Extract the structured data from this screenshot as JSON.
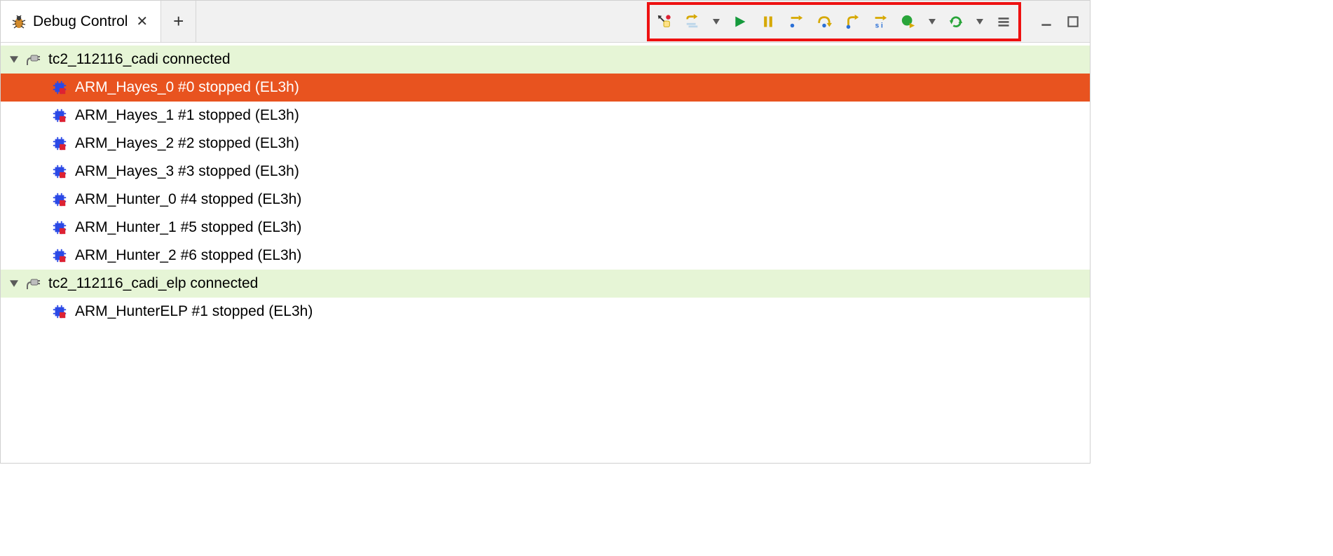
{
  "tab": {
    "title": "Debug Control"
  },
  "toolbar": {
    "buttons": [
      "connect",
      "stepmode",
      "run",
      "pause",
      "stepcode",
      "stepover",
      "stepout",
      "stepinstr",
      "runto",
      "refresh",
      "menu"
    ]
  },
  "connections": [
    {
      "name": "tc2_112116_cadi",
      "status": "connected",
      "expanded": true,
      "cores": [
        {
          "label": "ARM_Hayes_0 #0 stopped (EL3h)",
          "selected": true
        },
        {
          "label": "ARM_Hayes_1 #1 stopped (EL3h)",
          "selected": false
        },
        {
          "label": "ARM_Hayes_2 #2 stopped (EL3h)",
          "selected": false
        },
        {
          "label": "ARM_Hayes_3 #3 stopped (EL3h)",
          "selected": false
        },
        {
          "label": "ARM_Hunter_0 #4 stopped (EL3h)",
          "selected": false
        },
        {
          "label": "ARM_Hunter_1 #5 stopped (EL3h)",
          "selected": false
        },
        {
          "label": "ARM_Hunter_2 #6 stopped (EL3h)",
          "selected": false
        }
      ]
    },
    {
      "name": "tc2_112116_cadi_elp",
      "status": "connected",
      "expanded": true,
      "cores": [
        {
          "label": "ARM_HunterELP #1 stopped (EL3h)",
          "selected": false
        }
      ]
    }
  ]
}
